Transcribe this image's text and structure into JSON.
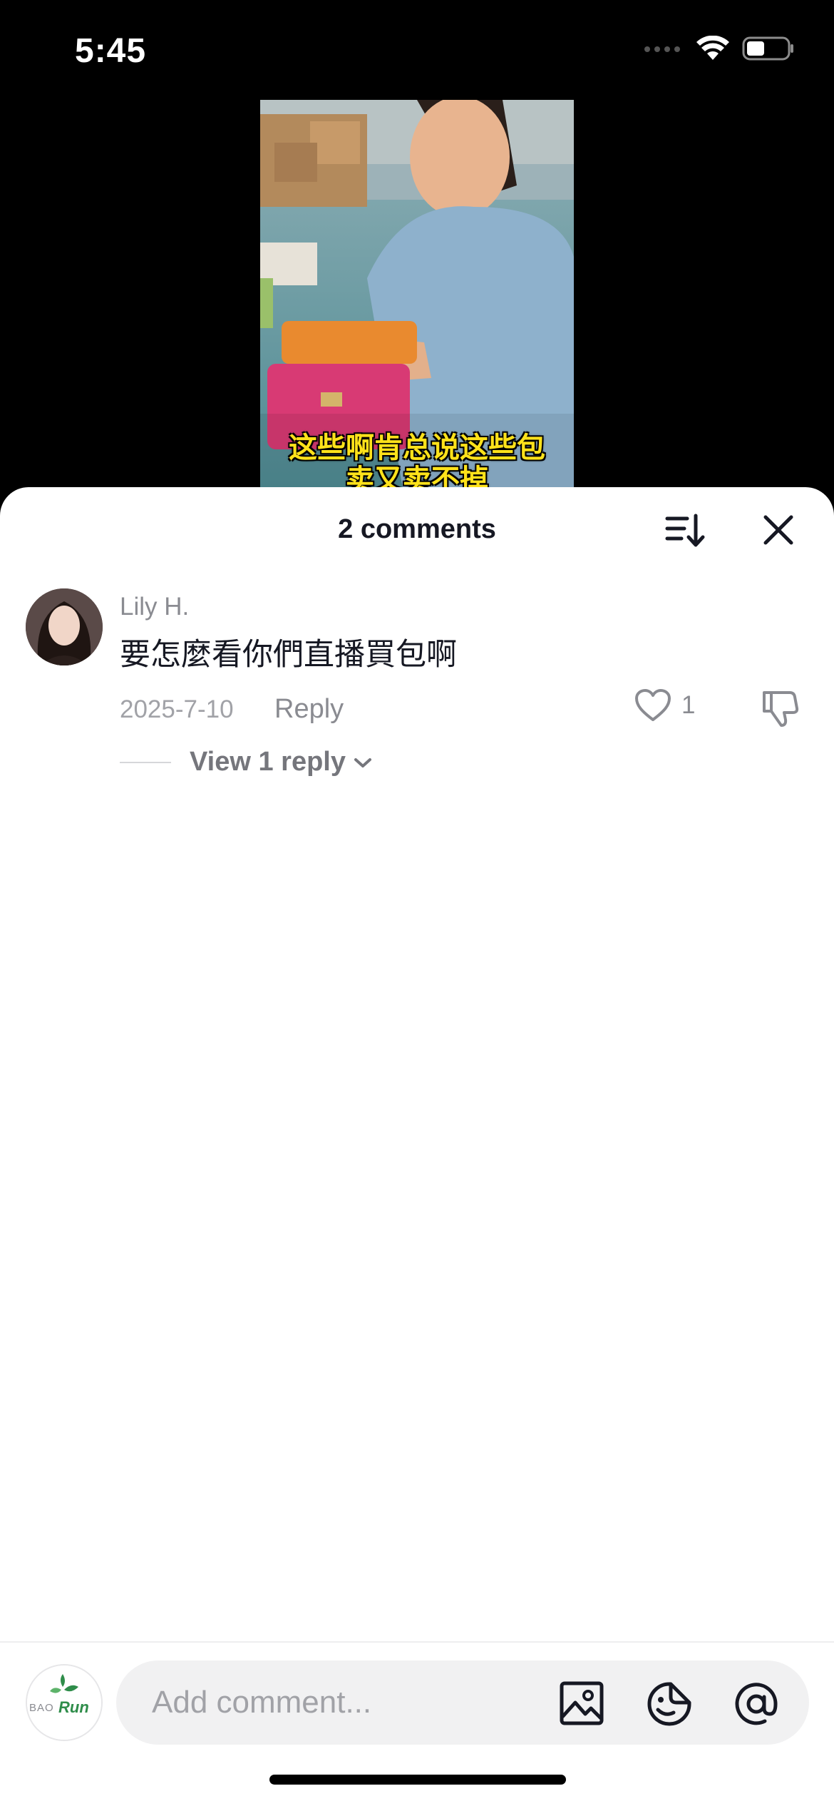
{
  "status_bar": {
    "time": "5:45"
  },
  "video": {
    "caption_line1": "这些啊肯总说这些包",
    "caption_line2": "卖又卖不掉"
  },
  "comments_sheet": {
    "title": "2 comments",
    "comments": [
      {
        "username": "Lily H.",
        "text": "要怎麼看你們直播買包啊",
        "date": "2025-7-10",
        "reply_label": "Reply",
        "like_count": "1",
        "view_replies_label": "View 1 reply"
      }
    ]
  },
  "composer": {
    "avatar_logo_text": "BAORun",
    "placeholder": "Add comment..."
  },
  "colors": {
    "caption_yellow": "#ffe21a",
    "text_primary": "#161823",
    "text_secondary": "#8a8b91",
    "input_bg": "#f1f1f2"
  },
  "icons": [
    "wifi-icon",
    "battery-icon",
    "signal-icon",
    "sort-icon",
    "close-icon",
    "heart-icon",
    "dislike-icon",
    "chevron-down-icon",
    "image-icon",
    "sticker-icon",
    "mention-icon"
  ]
}
